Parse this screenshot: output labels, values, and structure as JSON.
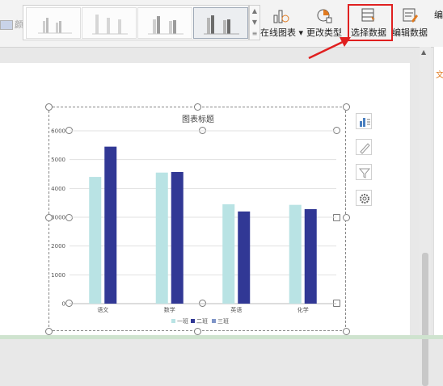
{
  "ribbon": {
    "color_label": "颜色",
    "online_chart_label": "在线图表",
    "change_type_label": "更改类型",
    "select_data_label": "选择数据",
    "edit_data_label": "编辑数据",
    "partial_label": "编"
  },
  "colors": {
    "series1": "#b9e3e4",
    "series2": "#313895",
    "highlight": "#e02020",
    "arrow": "#e02020",
    "accent": "#e07a20"
  },
  "icons": [
    "online-chart-icon",
    "change-type-icon",
    "select-data-icon",
    "edit-data-icon",
    "chart-elements-icon",
    "chart-style-icon",
    "chart-filter-icon",
    "chart-settings-icon"
  ],
  "side_panel": {
    "mark": "文"
  },
  "chart_data": {
    "type": "bar",
    "title": "图表标题",
    "categories": [
      "语文",
      "数学",
      "英语",
      "化学"
    ],
    "series": [
      {
        "name": "一班",
        "values": [
          4400,
          4550,
          3450,
          3430
        ]
      },
      {
        "name": "二班",
        "values": [
          5450,
          4570,
          3200,
          3280
        ]
      },
      {
        "name": "三班",
        "values": [
          0,
          0,
          0,
          0
        ]
      }
    ],
    "yticks": [
      "0",
      "1000",
      "2000",
      "3000",
      "4000",
      "5000",
      "6000"
    ],
    "ylim": [
      0,
      6000
    ],
    "grid": true,
    "legend": "bottom"
  }
}
